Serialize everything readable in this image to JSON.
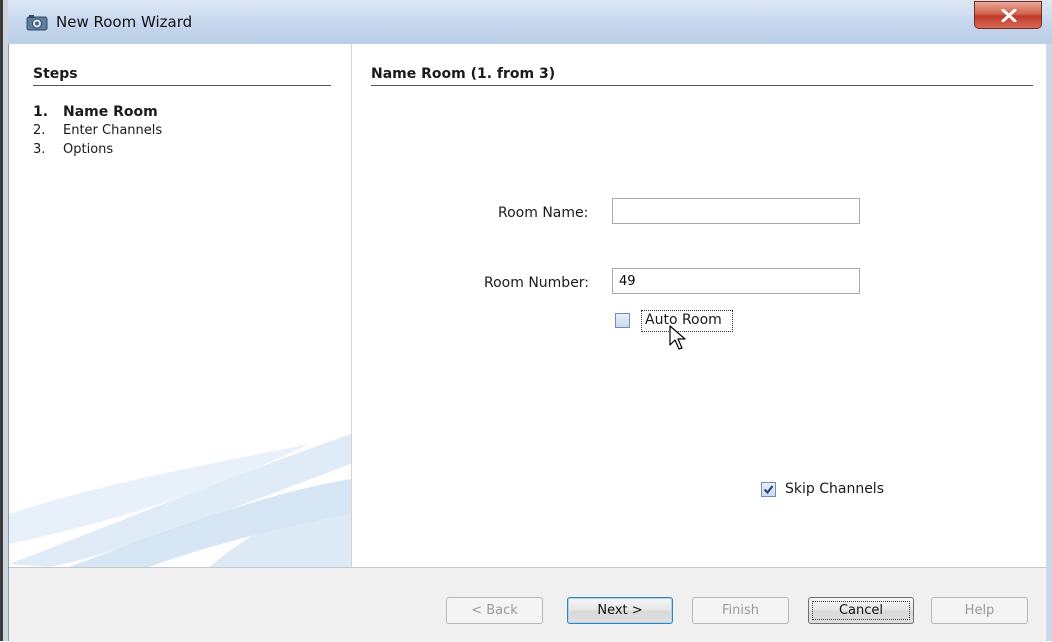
{
  "window": {
    "title": "New Room Wizard",
    "close_glyph": "✕",
    "icon": "wizard-app-icon"
  },
  "steps": {
    "heading": "Steps",
    "items": [
      {
        "number": "1.",
        "label": "Name Room",
        "active": true
      },
      {
        "number": "2.",
        "label": "Enter Channels",
        "active": false
      },
      {
        "number": "3.",
        "label": "Options",
        "active": false
      }
    ]
  },
  "main": {
    "title": "Name Room (1. from 3)",
    "room_name": {
      "label": "Room Name:",
      "value": ""
    },
    "room_number": {
      "label": "Room Number:",
      "value": "49"
    },
    "auto_room": {
      "label": "Auto Room",
      "checked": false
    },
    "skip_channels": {
      "label": "Skip Channels",
      "checked": true
    }
  },
  "buttons": {
    "back": "< Back",
    "next": "Next >",
    "finish": "Finish",
    "cancel": "Cancel",
    "help": "Help"
  },
  "colors": {
    "titlebar": "#c9d9ee",
    "close": "#c0392b",
    "checkbox_accent": "#6f8fb8"
  }
}
